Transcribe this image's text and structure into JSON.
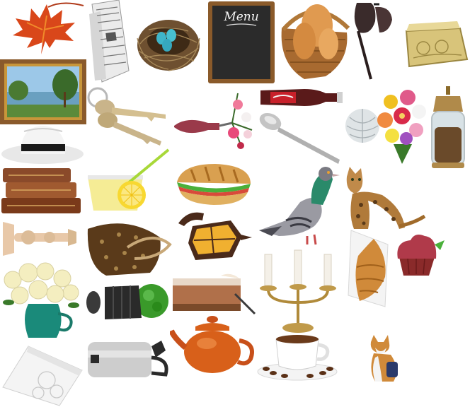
{
  "scene": {
    "background": "#ffffff",
    "objects": [
      {
        "icon": "maple-leaf-icon",
        "color": "#d9471a"
      },
      {
        "icon": "newspaper-icon",
        "color": "#d9d9d9"
      },
      {
        "icon": "bird-nest-icon",
        "color": "#7a5a36"
      },
      {
        "icon": "chalkboard-menu-icon",
        "color": "#2b2b2b"
      },
      {
        "icon": "bread-basket-icon",
        "color": "#b0733a"
      },
      {
        "icon": "sunglasses-icon",
        "color": "#3a2b2b"
      },
      {
        "icon": "ornate-box-icon",
        "color": "#c9b467"
      },
      {
        "icon": "framed-landscape-icon",
        "color": "#8a5a2b"
      },
      {
        "icon": "keys-icon",
        "color": "#c9b48a"
      },
      {
        "icon": "cola-bottle-icon",
        "color": "#5a1a1a"
      },
      {
        "icon": "perfume-bottle-flowers-icon",
        "color": "#8a2a3a"
      },
      {
        "icon": "spoon-icon",
        "color": "#bdbdbd"
      },
      {
        "icon": "white-hat-icon",
        "color": "#f2f2f2"
      },
      {
        "icon": "yarn-ball-icon",
        "color": "#d8dde0"
      },
      {
        "icon": "flower-bouquet-icon",
        "color": "#e05a8a"
      },
      {
        "icon": "pepper-grinder-icon",
        "color": "#6a4a2a"
      },
      {
        "icon": "old-books-icon",
        "color": "#8a4a2a"
      },
      {
        "icon": "lemonade-glass-icon",
        "color": "#f2e060"
      },
      {
        "icon": "sandwich-icon",
        "color": "#d9a050"
      },
      {
        "icon": "pigeon-icon",
        "color": "#8f8f96"
      },
      {
        "icon": "bengal-cat-icon",
        "color": "#b07a3a"
      },
      {
        "icon": "candle-holder-icon",
        "color": "#e8c8a8"
      },
      {
        "icon": "handbag-icon",
        "color": "#5a3a1a"
      },
      {
        "icon": "lantern-icon",
        "color": "#4a2a1a"
      },
      {
        "icon": "croissant-icon",
        "color": "#d08a3a"
      },
      {
        "icon": "cupcake-icon",
        "color": "#8a2a2a"
      },
      {
        "icon": "rose-vase-icon",
        "color": "#1a8a7a"
      },
      {
        "icon": "plant-pot-icon",
        "color": "#3a9a2a"
      },
      {
        "icon": "iced-coffee-icon",
        "color": "#b0704a"
      },
      {
        "icon": "candelabra-icon",
        "color": "#b08a3a"
      },
      {
        "icon": "napkin-holder-icon",
        "color": "#f0f0f0"
      },
      {
        "icon": "thermos-jug-icon",
        "color": "#c8c8c8"
      },
      {
        "icon": "orange-teapot-icon",
        "color": "#d8601a"
      },
      {
        "icon": "coffee-cup-icon",
        "color": "#f5f5f5"
      },
      {
        "icon": "corgi-icon",
        "color": "#d08a3a"
      }
    ]
  },
  "menu_board": {
    "title": "Menu"
  }
}
